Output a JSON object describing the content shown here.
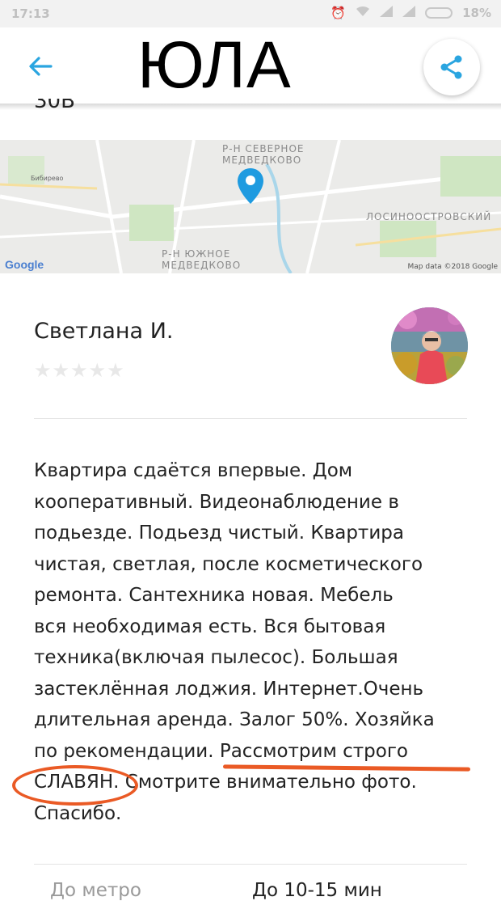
{
  "status_bar": {
    "time": "17:13",
    "battery": "18%"
  },
  "app_bar": {
    "title": "ЮЛА"
  },
  "cut_off_text": "30В",
  "map": {
    "labels": {
      "north_district": "Р-Н СЕВЕРНОЕ\nМЕДВЕДКОВО",
      "south_district": "Р-Н ЮЖНОЕ\nМЕДВЕДКОВО",
      "losinoostrovsky": "ЛОСИНООСТРОВСКИЙ",
      "bibirevo": "Бибирево"
    },
    "google_logo": "Google",
    "credit": "Map data ©2018 Google",
    "pin_color": "#1f9be0"
  },
  "seller": {
    "name": "Светлана И.",
    "rating": "★★★★★"
  },
  "description": {
    "line1": "Квартира сдаётся впервые. Дом",
    "line2": "кооперативный. Видеонаблюдение в",
    "line3": "подьезде. Подьезд чистый. Квартира",
    "line4": "чистая, светлая, после косметического",
    "line5": "ремонта. Сантехника новая. Мебель",
    "line6": "вся необходимая есть. Вся бытовая",
    "line7": "техника(включая пылесос). Большая",
    "line8": "застеклённая лоджия. Интернет.Очень",
    "line9": "длительная аренда. Залог 50%. Хозяйка",
    "line10": "по рекомендации. Рассмотрим строго",
    "line11": "СЛАВЯН. Смотрите внимательно фото.",
    "line12": "Спасибо."
  },
  "details": {
    "metro_label": "До метро",
    "metro_value": "До 10-15 мин"
  },
  "colors": {
    "accent": "#2aa5e0",
    "annotation": "#ea5a25"
  }
}
